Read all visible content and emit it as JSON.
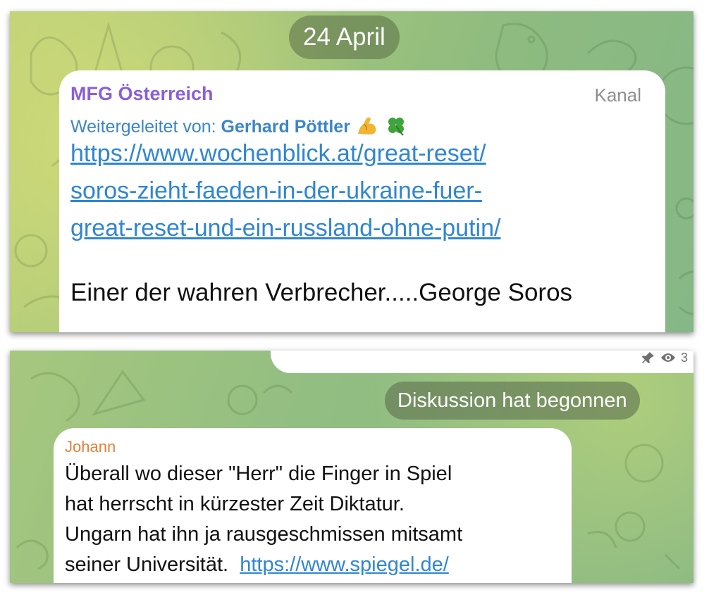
{
  "top_panel": {
    "date_label": "24 April",
    "post": {
      "channel_name": "MFG Österreich",
      "badge": "Kanal",
      "forwarded_prefix": "Weitergeleitet von:",
      "forwarded_author": "Gerhard Pöttler",
      "forwarded_emojis": [
        "flexed-biceps-icon",
        "four-leaf-clover-icon"
      ],
      "link_lines": [
        "https://www.wochenblick.at/great-reset/",
        "soros-zieht-faeden-in-der-ukraine-fuer-",
        "great-reset-und-ein-russland-ohne-putin/"
      ],
      "message": "Einer der wahren Verbrecher.....George Soros"
    }
  },
  "bottom_panel": {
    "previous_meta": {
      "icons": [
        "pin-icon",
        "eye-icon"
      ],
      "views_partial": "3"
    },
    "service_pill": "Diskussion hat begonnen",
    "comment": {
      "author": "Johann",
      "lines": [
        "Überall wo dieser \"Herr\" die Finger in Spiel",
        "hat herrscht in kürzester Zeit Diktatur.",
        "Ungarn hat ihn ja rausgeschmissen mitsamt"
      ],
      "last_line_text": "seiner Universität.",
      "last_line_link": "https://www.spiegel.de/"
    }
  },
  "colors": {
    "channel_name": "#8a5fd8",
    "link": "#2f86d2",
    "forward": "#3b86c6",
    "author": "#e1823a",
    "wallpaper": "#9cc37e"
  }
}
